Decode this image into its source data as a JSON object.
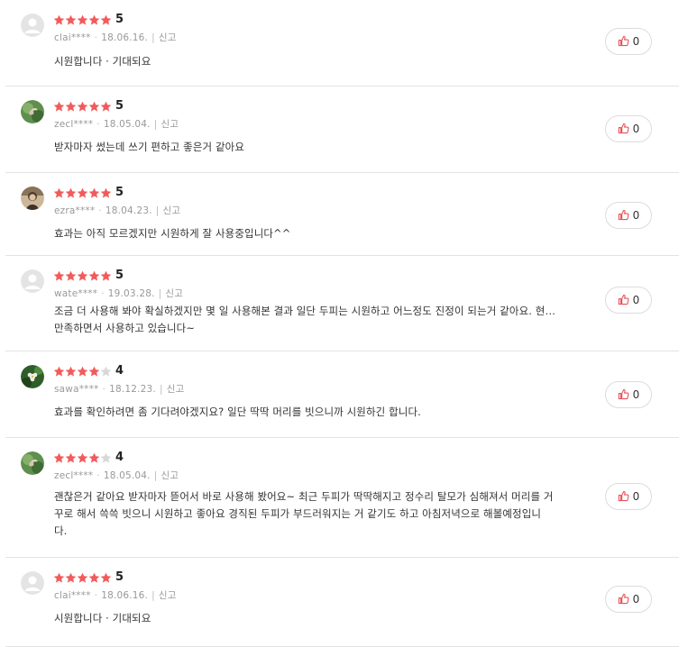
{
  "colors": {
    "star_on": "#f25b5b",
    "star_off": "#d8d8d8",
    "like_icon": "#e8535a",
    "divider": "#e3e3e3"
  },
  "reviews": [
    {
      "avatar": "default-avatar",
      "rating": 5,
      "score": "5",
      "user": "clai****",
      "date": "18.06.16.",
      "report": "신고",
      "lines": [
        "시원합니다 · 기대되요"
      ],
      "likes": "0"
    },
    {
      "avatar": "plant-photo-avatar",
      "rating": 5,
      "score": "5",
      "user": "zecl****",
      "date": "18.05.04.",
      "report": "신고",
      "lines": [
        "받자마자  썼는데 쓰기 편하고 좋은거 같아요"
      ],
      "likes": "0"
    },
    {
      "avatar": "person-photo-avatar",
      "rating": 5,
      "score": "5",
      "user": "ezra****",
      "date": "18.04.23.",
      "report": "신고",
      "lines": [
        "효과는 아직 모르겠지만 시원하게 잘 사용중입니다^^"
      ],
      "likes": "0"
    },
    {
      "avatar": "default-avatar",
      "rating": 5,
      "score": "5",
      "user": "wate****",
      "date": "19.03.28.",
      "report": "신고",
      "lines": [
        "조금 더 사용해 봐야 확실하겠지만 몇 일 사용해본 결과 일단 두피는 시원하고 어느정도 진정이 되는거 같아요. 현…",
        "만족하면서 사용하고 있습니다~"
      ],
      "likes": "0"
    },
    {
      "avatar": "flower-photo-avatar",
      "rating": 4,
      "score": "4",
      "user": "sawa****",
      "date": "18.12.23.",
      "report": "신고",
      "lines": [
        "효과를 확인하려면 좀 기다려야겠지요? 일단 딱딱 머리를 빗으니까 시원하긴 합니다."
      ],
      "likes": "0"
    },
    {
      "avatar": "plant-photo-avatar",
      "rating": 4,
      "score": "4",
      "user": "zecl****",
      "date": "18.05.04.",
      "report": "신고",
      "lines": [
        "괜찮은거 같아요 받자마자 뜯어서 바로 사용해 봤어요~ 최근 두피가 딱딱해지고 정수리 탈모가 심해져서 머리를 거",
        "꾸로 해서 쓱쓱 빗으니 시원하고 좋아요  경직된 두피가 부드러워지는 거 같기도 하고 아침저녁으로 해볼예정입니",
        "다."
      ],
      "likes": "0"
    },
    {
      "avatar": "default-avatar",
      "rating": 5,
      "score": "5",
      "user": "clai****",
      "date": "18.06.16.",
      "report": "신고",
      "lines": [
        "시원합니다 · 기대되요"
      ],
      "likes": "0"
    }
  ]
}
